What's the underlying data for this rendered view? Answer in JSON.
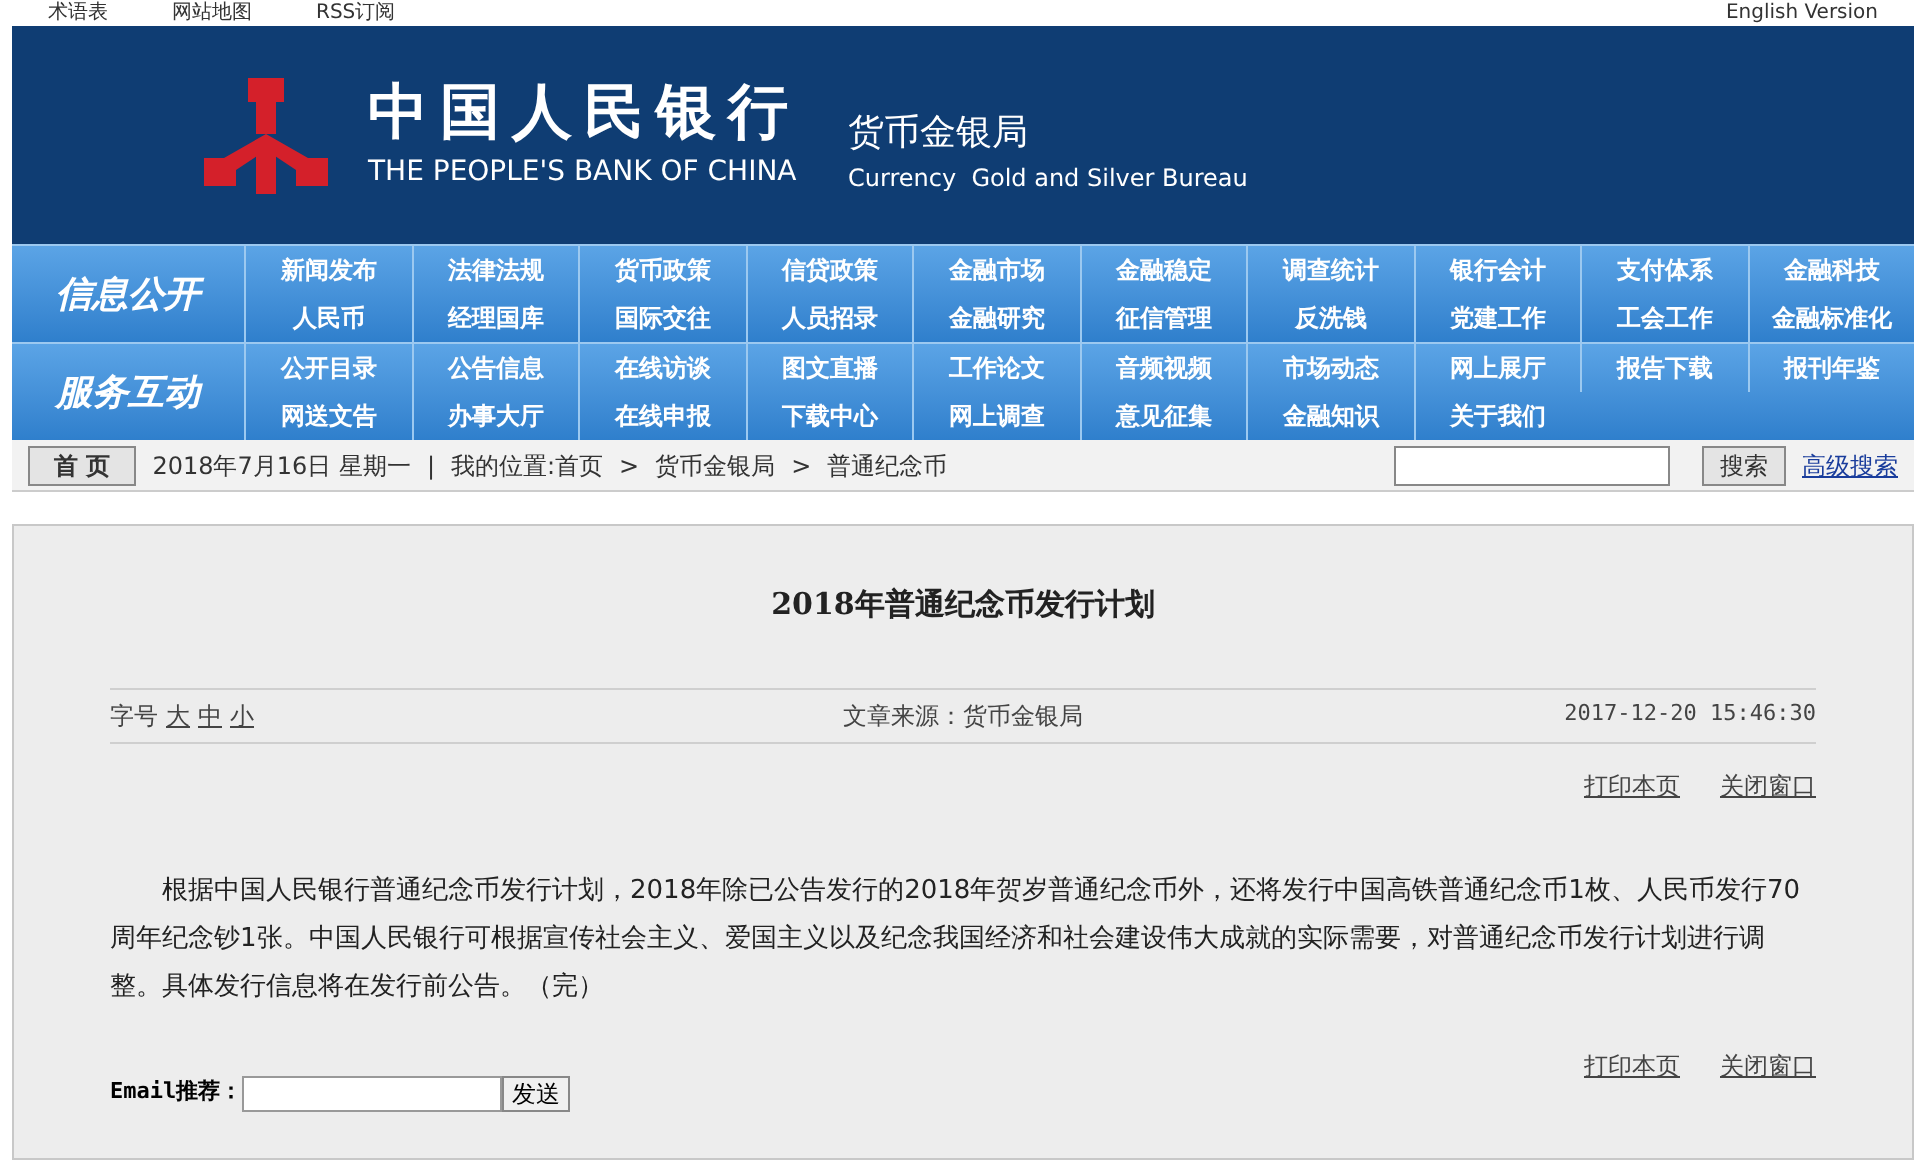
{
  "top_links": [
    {
      "text": "术语表"
    },
    {
      "text": "网站地图"
    },
    {
      "text": "RSS订阅"
    },
    {
      "text": "English Version"
    }
  ],
  "banner": {
    "logo_cn": "中国人民银行",
    "logo_en": "THE PEOPLE'S BANK OF CHINA",
    "bureau_cn": "货币金银局",
    "bureau_en": "Currency  Gold and Silver Bureau"
  },
  "nav": [
    {
      "section": "信息公开",
      "rows": [
        [
          "新闻发布",
          "法律法规",
          "货币政策",
          "信贷政策",
          "金融市场",
          "金融稳定",
          "调查统计",
          "银行会计",
          "支付体系",
          "金融科技"
        ],
        [
          "人民币",
          "经理国库",
          "国际交往",
          "人员招录",
          "金融研究",
          "征信管理",
          "反洗钱",
          "党建工作",
          "工会工作",
          "金融标准化"
        ]
      ]
    },
    {
      "section": "服务互动",
      "rows": [
        [
          "公开目录",
          "公告信息",
          "在线访谈",
          "图文直播",
          "工作论文",
          "音频视频",
          "市场动态",
          "网上展厅",
          "报告下载",
          "报刊年鉴"
        ],
        [
          "网送文告",
          "办事大厅",
          "在线申报",
          "下载中心",
          "网上调查",
          "意见征集",
          "金融知识",
          "关于我们"
        ]
      ]
    }
  ],
  "breadcrumb": {
    "home_button": "首 页",
    "date": "2018年7月16日 星期一",
    "date_separator": "|",
    "location_label": "我的位置:首页",
    "path": [
      "货币金银局",
      "普通纪念币"
    ],
    "separator": ">"
  },
  "search": {
    "button": "搜索",
    "advanced_link": "高级搜索"
  },
  "article": {
    "title": "2018年普通纪念币发行计划",
    "font_size_label": "字号",
    "font_sizes": [
      "大",
      "中",
      "小"
    ],
    "source": "文章来源：货币金银局",
    "datetime": "2017-12-20 15:46:30",
    "links_top": [
      "打印本页",
      "关闭窗口"
    ],
    "body": "根据中国人民银行普通纪念币发行计划，2018年除已公告发行的2018年贺岁普通纪念币外，还将发行中国高铁普通纪念币1枚、人民币发行70周年纪念钞1张。中国人民银行可根据宣传社会主义、爱国主义以及纪念我国经济和社会建设伟大成就的实际需要，对普通纪念币发行计划进行调整。具体发行信息将在发行前公告。（完）",
    "links_bottom": [
      "打印本页",
      "关闭窗口"
    ],
    "email_label": "Email推荐：",
    "send_button": "发送"
  }
}
